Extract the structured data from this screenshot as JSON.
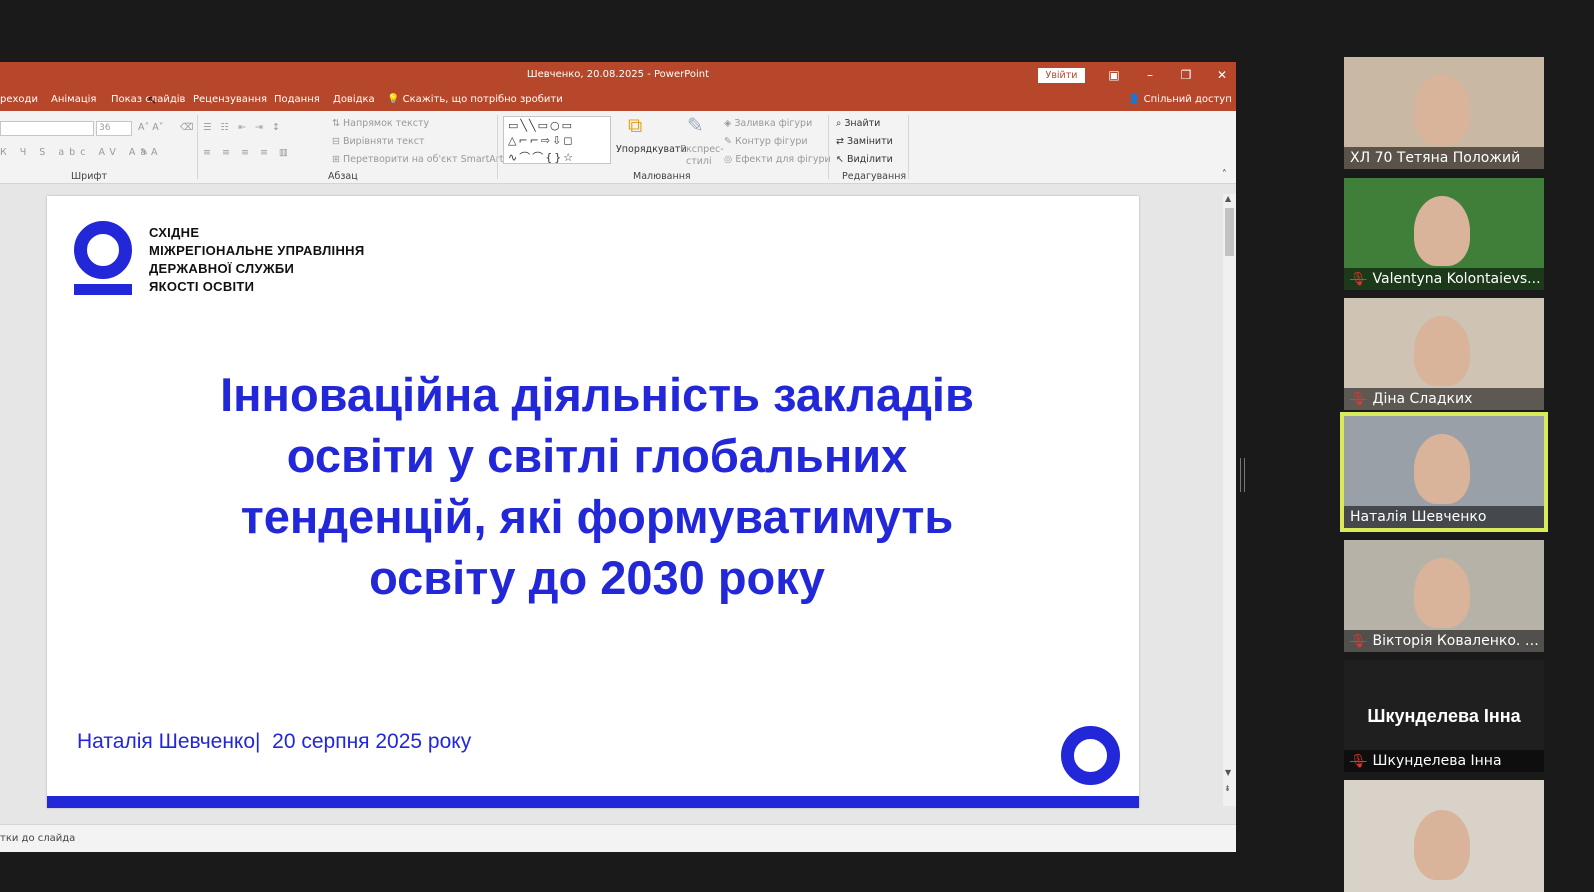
{
  "window": {
    "title": "Шевченко, 20.08.2025  -  PowerPoint",
    "sign_in": "Увійти"
  },
  "tabs": [
    {
      "label": "реходи"
    },
    {
      "label": "Анімація"
    },
    {
      "label": "Показ слайдів"
    },
    {
      "label": "Рецензування"
    },
    {
      "label": "Подання"
    },
    {
      "label": "Довідка"
    }
  ],
  "tell_me": "Скажіть, що потрібно зробити",
  "shared_access": "Спільний доступ",
  "ribbon": {
    "font_size_value": "36",
    "groups": {
      "font": "Шрифт",
      "paragraph": "Абзац",
      "drawing": "Малювання",
      "editing": "Редагування"
    },
    "paragraph_cmds": {
      "text_direction": "Напрямок тексту",
      "align_text": "Вирівняти текст",
      "convert_smartart": "Перетворити на об'єкт SmartArt"
    },
    "drawing_cmds": {
      "arrange": "Упорядкувати",
      "quick_styles_1": "Експрес-",
      "quick_styles_2": "стилі",
      "shape_fill": "Заливка фігури",
      "shape_outline": "Контур фігури",
      "shape_effects": "Ефекти для фігури"
    },
    "editing_cmds": {
      "find": "Знайти",
      "replace": "Замінити",
      "select": "Виділити"
    }
  },
  "slide": {
    "org_lines": [
      "СХІДНЕ",
      "МІЖРЕГІОНАЛЬНЕ УПРАВЛІННЯ",
      "ДЕРЖАВНОЇ СЛУЖБИ",
      "ЯКОСТІ ОСВІТИ"
    ],
    "title_lines": [
      "Інноваційна діяльність закладів",
      "освіти у світлі глобальних",
      "тенденцій, які формуватимуть",
      "освіту до 2030 року"
    ],
    "author_line": "Наталія Шевченко|  20 серпня 2025 року",
    "accent_color": "#2227d8"
  },
  "status": {
    "notes_hint": "тки до слайда"
  },
  "participants": [
    {
      "name": "ХЛ 70 Тетяна Положий",
      "muted": false,
      "active": false,
      "bg": "#c9b9a4"
    },
    {
      "name": "Valentyna Kolontaievs...",
      "muted": true,
      "active": false,
      "bg": "#3f7f3a"
    },
    {
      "name": "Діна Сладких",
      "muted": true,
      "active": false,
      "bg": "#cfc3b3"
    },
    {
      "name": "Наталія Шевченко",
      "muted": false,
      "active": true,
      "bg": "#9aa0a8"
    },
    {
      "name": "Вікторія Коваленко. С...",
      "muted": true,
      "active": false,
      "bg": "#b7b2a8"
    },
    {
      "name": "Шкунделева Інна",
      "muted": true,
      "active": false,
      "bg": "#1f1f1f",
      "big_name": "Шкунделева Інна"
    },
    {
      "name": "",
      "muted": false,
      "active": false,
      "bg": "#d8d2c8"
    }
  ]
}
